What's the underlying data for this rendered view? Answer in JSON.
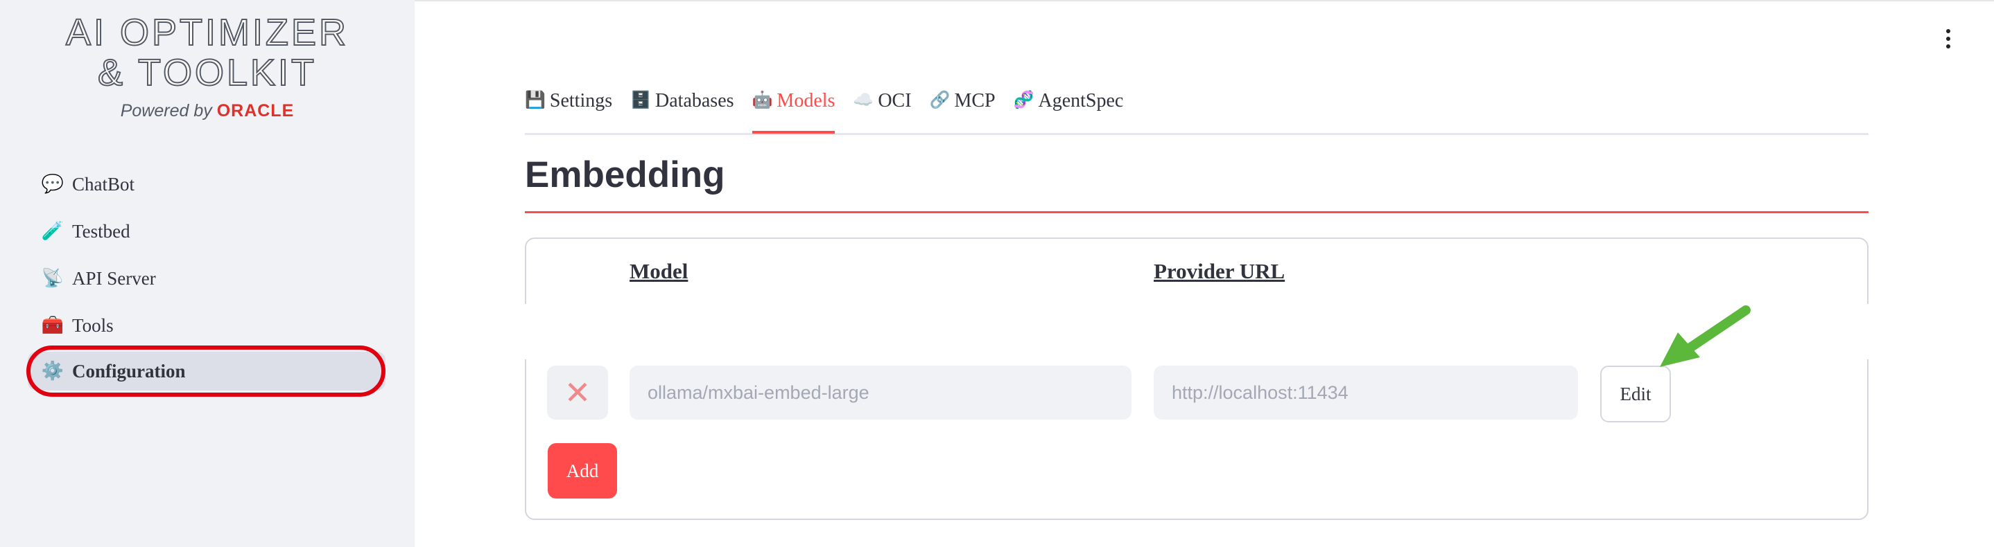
{
  "brand": {
    "line1": "AI OPTIMIZER",
    "line2": "& TOOLKIT",
    "powered_by": "Powered by",
    "vendor": "ORACLE"
  },
  "sidebar": {
    "items": [
      {
        "label": "ChatBot",
        "icon": "speech-bubble-icon",
        "glyph": "💬"
      },
      {
        "label": "Testbed",
        "icon": "test-tube-icon",
        "glyph": "🧪"
      },
      {
        "label": "API Server",
        "icon": "satellite-icon",
        "glyph": "📡"
      },
      {
        "label": "Tools",
        "icon": "toolbox-icon",
        "glyph": "🧰"
      },
      {
        "label": "Configuration",
        "icon": "gear-icon",
        "glyph": "⚙️",
        "active": true
      }
    ]
  },
  "tabs": [
    {
      "label": "Settings",
      "glyph": "💾",
      "icon": "floppy-disk-icon"
    },
    {
      "label": "Databases",
      "glyph": "🗄️",
      "icon": "file-cabinet-icon"
    },
    {
      "label": "Models",
      "glyph": "🤖",
      "icon": "robot-icon",
      "active": true
    },
    {
      "label": "OCI",
      "glyph": "☁️",
      "icon": "cloud-icon"
    },
    {
      "label": "MCP",
      "glyph": "🔗",
      "icon": "link-icon"
    },
    {
      "label": "AgentSpec",
      "glyph": "🧬",
      "icon": "dna-icon"
    }
  ],
  "section": {
    "title": "Embedding",
    "columns": {
      "model": "Model",
      "provider_url": "Provider URL"
    },
    "rows": [
      {
        "model": "ollama/mxbai-embed-large",
        "provider_url": "http://localhost:11434",
        "delete_glyph": "✕",
        "edit_label": "Edit"
      }
    ],
    "add_label": "Add"
  },
  "colors": {
    "accent": "#ff4b4b",
    "highlight_ring": "#e0000f",
    "annotation_arrow": "#5cb83a",
    "sidebar_bg": "#f0f2f6"
  }
}
